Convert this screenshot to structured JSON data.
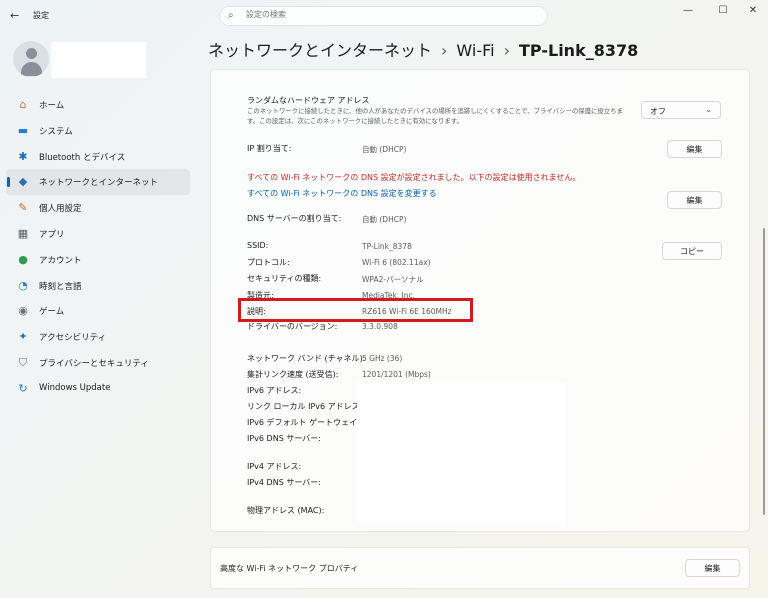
{
  "window": {
    "title": "設定",
    "search_placeholder": "設定の検索",
    "back_glyph": "←",
    "minimize_glyph": "—",
    "maximize_glyph": "☐",
    "close_glyph": "✕"
  },
  "sidebar": {
    "items": [
      {
        "label": "ホーム",
        "icon": "home-icon",
        "glyph": "⌂",
        "color": "#c07a3a"
      },
      {
        "label": "システム",
        "icon": "monitor-icon",
        "glyph": "▬",
        "color": "#1f7ed6"
      },
      {
        "label": "Bluetooth とデバイス",
        "icon": "bluetooth-icon",
        "glyph": "✱",
        "color": "#1f6fbf"
      },
      {
        "label": "ネットワークとインターネット",
        "icon": "wifi-icon",
        "glyph": "◆",
        "color": "#2a6fb0"
      },
      {
        "label": "個人用設定",
        "icon": "brush-icon",
        "glyph": "✎",
        "color": "#c46a2a"
      },
      {
        "label": "アプリ",
        "icon": "apps-icon",
        "glyph": "▦",
        "color": "#5a5f6a"
      },
      {
        "label": "アカウント",
        "icon": "account-icon",
        "glyph": "●",
        "color": "#2e9a56"
      },
      {
        "label": "時刻と言語",
        "icon": "globe-clock-icon",
        "glyph": "◔",
        "color": "#2a7fc4"
      },
      {
        "label": "ゲーム",
        "icon": "gamepad-icon",
        "glyph": "◉",
        "color": "#6a6f78"
      },
      {
        "label": "アクセシビリティ",
        "icon": "accessibility-icon",
        "glyph": "✦",
        "color": "#2a6fb0"
      },
      {
        "label": "プライバシーとセキュリティ",
        "icon": "shield-icon",
        "glyph": "⛉",
        "color": "#6a6f78"
      },
      {
        "label": "Windows Update",
        "icon": "update-icon",
        "glyph": "↻",
        "color": "#1f7ed6"
      }
    ],
    "active_index": 3
  },
  "breadcrumb": {
    "part1": "ネットワークとインターネット",
    "sep": "›",
    "part2": "Wi-Fi",
    "part3": "TP-Link_8378"
  },
  "random_hw": {
    "title": "ランダムなハードウェア アドレス",
    "desc": "このネットワークに接続したときに、他の人があなたのデバイスの場所を追跡しにくくすることで、プライバシーの保護に役立ちます。この設定は、次にこのネットワークに接続したときに有効になります。",
    "dropdown_value": "オフ"
  },
  "ip": {
    "label": "IP 割り当て:",
    "value": "自動 (DHCP)",
    "edit": "編集"
  },
  "dns": {
    "warning": "すべての Wi-Fi ネットワークの DNS 設定が設定されました。以下の設定は使用されません。",
    "link": "すべての Wi-Fi ネットワークの DNS 設定を変更する",
    "label": "DNS サーバーの割り当て:",
    "value": "自動 (DHCP)",
    "edit": "編集"
  },
  "props": {
    "copy": "コピー",
    "rows": [
      {
        "label": "SSID:",
        "value": "TP-Link_8378"
      },
      {
        "label": "プロトコル:",
        "value": "Wi-Fi 6 (802.11ax)"
      },
      {
        "label": "セキュリティの種類:",
        "value": "WPA2-パーソナル"
      },
      {
        "label": "製造元:",
        "value": "MediaTek, Inc."
      },
      {
        "label": "説明:",
        "value": "RZ616 Wi-Fi 6E 160MHz"
      },
      {
        "label": "ドライバーのバージョン:",
        "value": "3.3.0.908"
      }
    ],
    "rows2": [
      {
        "label": "ネットワーク バンド (チャネル):",
        "value": "5 GHz (36)"
      },
      {
        "label": "集計リンク速度 (送受信):",
        "value": "1201/1201 (Mbps)"
      },
      {
        "label": "IPv6 アドレス:"
      },
      {
        "label": "リンク ローカル IPv6 アドレス:"
      },
      {
        "label": "IPv6 デフォルト ゲートウェイ:"
      },
      {
        "label": "IPv6 DNS サーバー:"
      },
      {
        "label": "IPv4 アドレス:"
      },
      {
        "label": "IPv4 DNS サーバー:"
      },
      {
        "label": "物理アドレス (MAC):"
      }
    ]
  },
  "advanced": {
    "label": "高度な Wi-Fi ネットワーク プロパティ",
    "edit": "編集"
  }
}
